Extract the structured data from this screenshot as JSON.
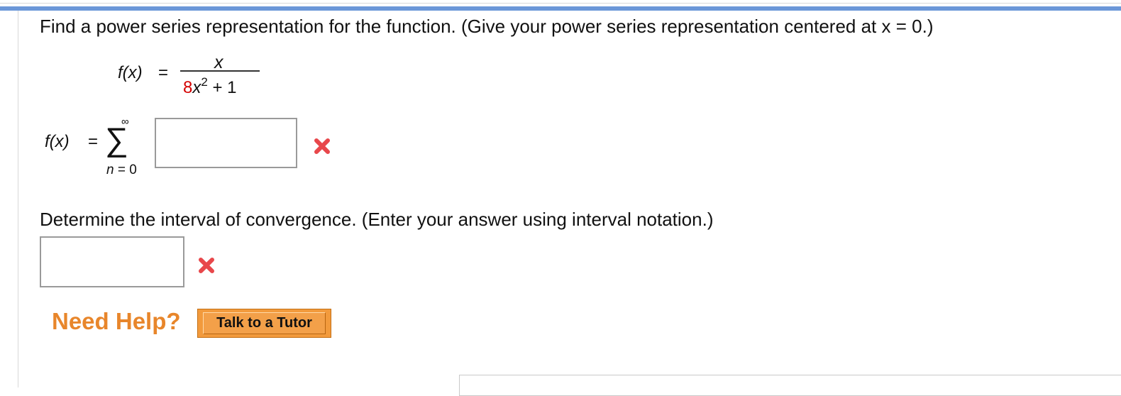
{
  "question": {
    "text": "Find a power series representation for the function. (Give your power series representation centered at x = 0.)"
  },
  "function": {
    "lhs": "f(x)",
    "equals": "=",
    "numerator": "x",
    "denominator_coef": "8",
    "denominator_var": "x",
    "denominator_exp": "2",
    "denominator_rest": " + 1",
    "coef_color": "#d40000"
  },
  "series": {
    "lhs": "f(x)",
    "equals": "=",
    "upper_limit": "∞",
    "sum_symbol": "∑",
    "lower_index_var": "n",
    "lower_index_rest": " = 0",
    "answer_value": "",
    "status": "incorrect"
  },
  "interval": {
    "question": "Determine the interval of convergence. (Enter your answer using interval notation.)",
    "answer_value": "",
    "status": "incorrect"
  },
  "help": {
    "label": "Need Help?",
    "tutor_button_label": "Talk to a Tutor"
  },
  "icons": {
    "incorrect": "incorrect-x-icon"
  },
  "colors": {
    "accent_bar": "#6b97d8",
    "incorrect": "#e8474b",
    "help_text": "#e8862b",
    "button": "#f29a3c"
  }
}
